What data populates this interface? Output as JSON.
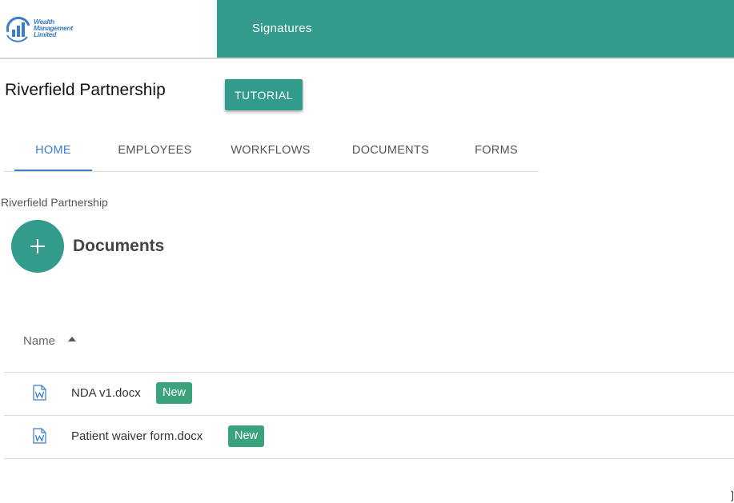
{
  "header": {
    "logo_line1": "Wealth",
    "logo_line2": "Management",
    "logo_line3": "Limited",
    "app_title": "Signatures",
    "accent_color": "#339b8c"
  },
  "company": {
    "name": "Riverfield Partnership",
    "tutorial_label": "TUTORIAL"
  },
  "tabs": [
    {
      "label": "HOME",
      "active": true
    },
    {
      "label": "EMPLOYEES",
      "active": false
    },
    {
      "label": "WORKFLOWS",
      "active": false
    },
    {
      "label": "DOCUMENTS",
      "active": false
    },
    {
      "label": "FORMS",
      "active": false
    }
  ],
  "breadcrumb": "Riverfield Partnership",
  "documents": {
    "title": "Documents",
    "add_icon": "plus-icon",
    "column_name": "Name",
    "sort_icon": "sort-ascending-icon",
    "files": [
      {
        "name": "NDA v1.docx",
        "badge": "New",
        "icon": "word-doc-icon"
      },
      {
        "name": "Patient waiver form.docx",
        "badge": "New",
        "icon": "word-doc-icon"
      }
    ]
  },
  "colors": {
    "primary": "#339b8c",
    "tab_active": "#3a7dc9",
    "badge": "#3aa37b"
  }
}
